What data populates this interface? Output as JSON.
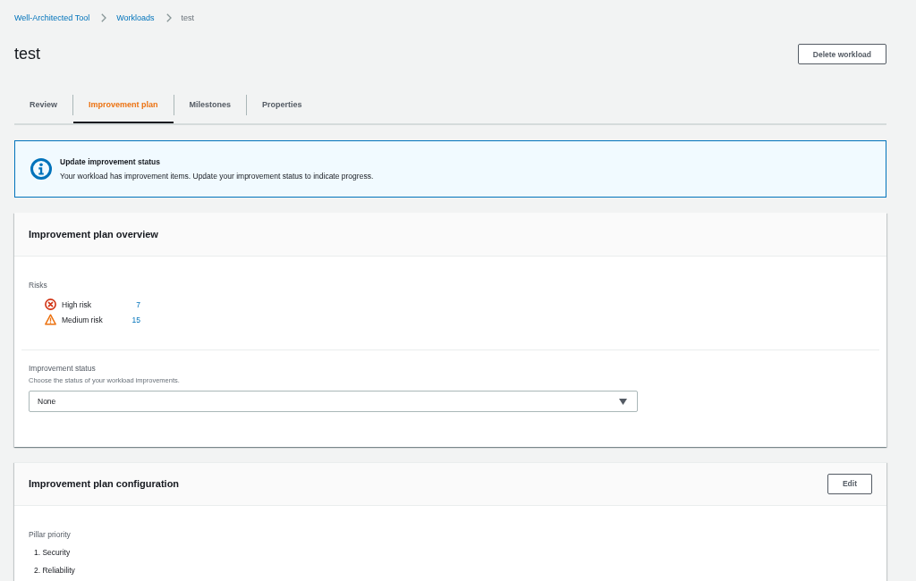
{
  "breadcrumbs": [
    {
      "label": "Well-Architected Tool",
      "current": false
    },
    {
      "label": "Workloads",
      "current": false
    },
    {
      "label": "test",
      "current": true
    }
  ],
  "header": {
    "title": "test",
    "button": "Delete workload"
  },
  "tabs": [
    {
      "label": "Review",
      "selected": false
    },
    {
      "label": "Improvement plan",
      "selected": true
    },
    {
      "label": "Milestones",
      "selected": false
    },
    {
      "label": "Properties",
      "selected": false
    }
  ],
  "alert": {
    "kind": "info",
    "title": "Update improvement status",
    "message": "Your workload has improvement items. Update your improvement status to indicate progress."
  },
  "overview": {
    "title": "Improvement plan overview",
    "risks_label": "Risks",
    "risks": [
      {
        "kind": "high",
        "label": "High risk",
        "count": "7"
      },
      {
        "kind": "medium",
        "label": "Medium risk",
        "count": "15"
      }
    ],
    "status_field": {
      "label": "Improvement status",
      "description": "Choose the status of your workload improvements.",
      "value": "None"
    }
  },
  "configuration": {
    "title": "Improvement plan configuration",
    "button": "Edit",
    "pillar_label": "Pillar priority",
    "pillars": [
      "1. Security",
      "2. Reliability"
    ]
  }
}
